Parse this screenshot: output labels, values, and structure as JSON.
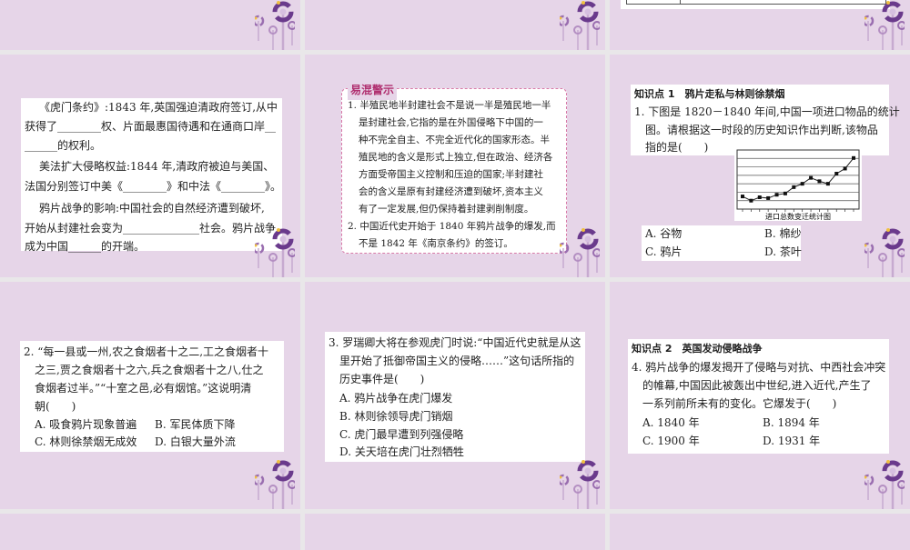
{
  "colors": {
    "slide_bg": "#e6d5e8",
    "gap": "#e9e7e9",
    "decoration_purple": "#6a3a8c",
    "warning_border": "#d87aa8"
  },
  "slide1": {
    "lines": [
      "《虎门条约》:1843 年,英国强迫清政府签订,从中",
      "获得了________权、片面最惠国待遇和在通商口岸__",
      "______的权利。",
      "美法扩大侵略权益:1844 年,清政府被迫与美国、",
      "法国分别签订中美《________》和中法《________》。",
      "鸦片战争的影响:中国社会的自然经济遭到破坏,",
      "开始从封建社会变为______________社会。鸦片战争",
      "成为中国______的开端。"
    ]
  },
  "slide2": {
    "badge": "易混警示",
    "lines": [
      "1. 半殖民地半封建社会不是说一半是殖民地一半",
      "是封建社会,它指的是在外国侵略下中国的一",
      "种不完全自主、不完全近代化的国家形态。半",
      "殖民地的含义是形式上独立,但在政治、经济各",
      "方面受帝国主义控制和压迫的国家;半封建社",
      "会的含义是原有封建经济遭到破坏,资本主义",
      "有了一定发展,但仍保持着封建剥削制度。",
      "2. 中国近代史开始于 1840 年鸦片战争的爆发,而",
      "不是 1842 年《南京条约》的签订。"
    ]
  },
  "slide3": {
    "heading": "知识点 1　鸦片走私与林则徐禁烟",
    "lines": [
      "1. 下图是 1820－1840 年间,中国一项进口物品的统计",
      "图。请根据这一时段的历史知识作出判断,该物品",
      "指的是(　　)"
    ],
    "options": [
      "A. 谷物",
      "B. 棉纱",
      "C. 鸦片",
      "D. 茶叶"
    ]
  },
  "chart_data": {
    "type": "line",
    "title": "进口总数变迁统计图",
    "xlabel": "",
    "ylabel": "",
    "values": [
      1.5,
      1.0,
      1.4,
      1.3,
      1.7,
      1.85,
      2.6,
      3.0,
      3.7,
      3.3,
      3.0,
      4.2,
      4.8,
      6.05
    ],
    "ylim": [
      0,
      7
    ],
    "grid": "horizontal"
  },
  "slide4": {
    "lines": [
      "2. “每一县或一州,农之食烟者十之二,工之食烟者十",
      "之三,贾之食烟者十之六,兵之食烟者十之八,仕之",
      "食烟者过半。”“十室之邑,必有烟馆。”这说明清",
      "朝(　　)"
    ],
    "options": [
      "A. 吸食鸦片现象普遍",
      "B. 军民体质下降",
      "C. 林则徐禁烟无成效",
      "D. 白银大量外流"
    ]
  },
  "slide5": {
    "lines": [
      "3. 罗瑞卿大将在参观虎门时说:“中国近代史就是从这",
      "里开始了抵御帝国主义的侵略……”这句话所指的",
      "历史事件是(　　)"
    ],
    "options": [
      "A. 鸦片战争在虎门爆发",
      "B. 林则徐领导虎门销烟",
      "C. 虎门最早遭到列强侵略",
      "D. 关天培在虎门壮烈牺牲"
    ]
  },
  "slide6": {
    "heading": "知识点 2　英国发动侵略战争",
    "lines": [
      "4. 鸦片战争的爆发揭开了侵略与对抗、中西社会冲突",
      "的帷幕,中国因此被轰出中世纪,进入近代,产生了",
      "一系列前所未有的变化。它爆发于(　　)"
    ],
    "options": [
      "A. 1840 年",
      "B. 1894 年",
      "C. 1900 年",
      "D. 1931 年"
    ]
  }
}
